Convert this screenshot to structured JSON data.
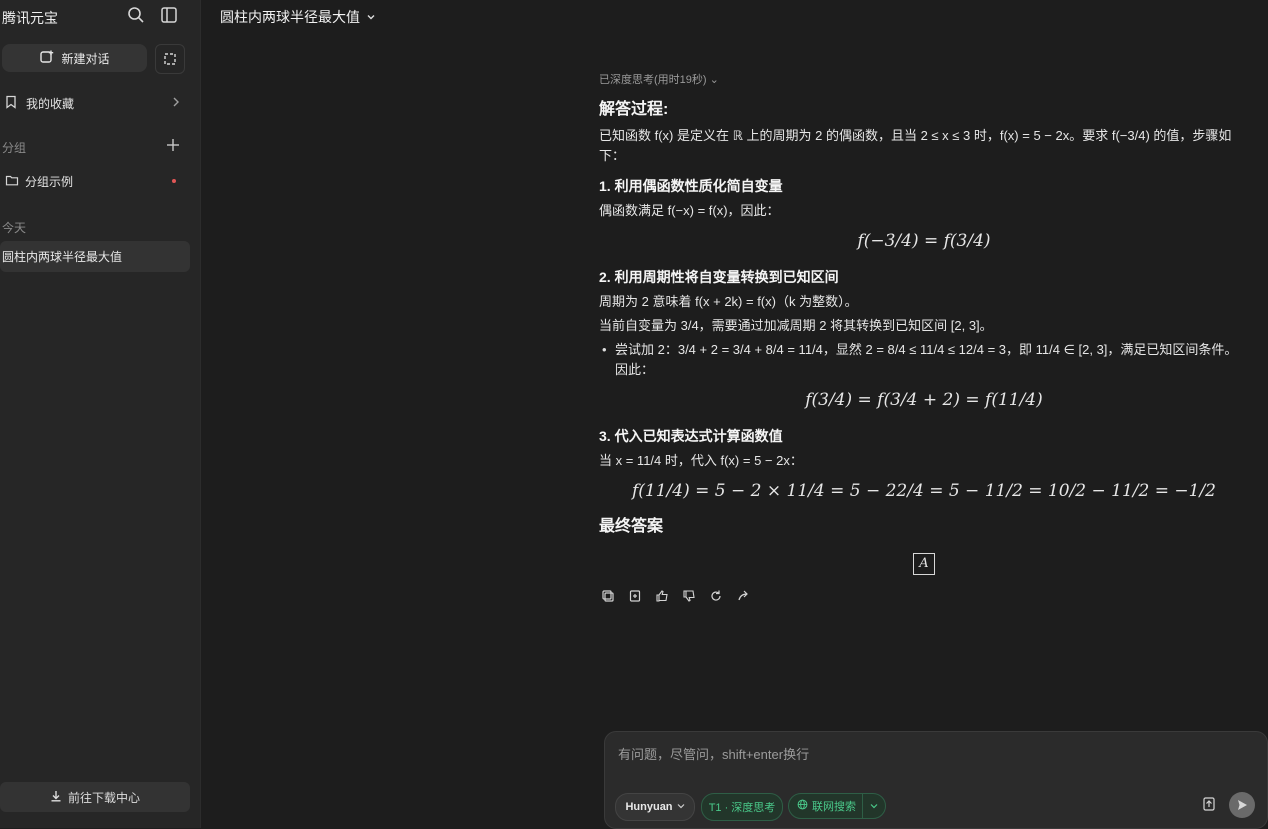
{
  "app": {
    "title": "腾讯元宝",
    "new_chat_label": "新建对话"
  },
  "sidebar": {
    "favorites_label": "我的收藏",
    "groups_label": "分组",
    "group_example_label": "分组示例",
    "today_label": "今天",
    "selected_chat": "圆柱内两球半径最大值",
    "download_label": "前往下载中心"
  },
  "header": {
    "chat_title": "圆柱内两球半径最大值"
  },
  "answer": {
    "thinking": "已深度思考(用时19秒)",
    "heading": "解答过程:",
    "intro": "已知函数 f(x) 是定义在 ℝ 上的周期为 2 的偶函数，且当 2 ≤ x ≤ 3 时，f(x) = 5 − 2x。要求 f(−3/4) 的值，步骤如下：",
    "steps": [
      {
        "title": "1. 利用偶函数性质化简自变量",
        "text": "偶函数满足 f(−x) = f(x)，因此：",
        "display": "f(−3/4) = f(3/4)"
      },
      {
        "title": "2. 利用周期性将自变量转换到已知区间",
        "text1": "周期为 2 意味着 f(x + 2k) = f(x)（k 为整数）。",
        "text2": "当前自变量为 3/4，需要通过加减周期 2 将其转换到已知区间 [2, 3]。",
        "bullet1": "尝试加 2：3/4 + 2 = 3/4 + 8/4 = 11/4，显然 2 = 8/4 ≤ 11/4 ≤ 12/4 = 3，即 11/4 ∈ [2, 3]，满足已知区间条件。",
        "bullet2": "因此：",
        "display": "f(3/4) = f(3/4 + 2) = f(11/4)"
      },
      {
        "title": "3. 代入已知表达式计算函数值",
        "text": "当 x = 11/4 时，代入 f(x) = 5 − 2x：",
        "display": "f(11/4) = 5 − 2 × 11/4 = 5 − 22/4 = 5 − 11/2 = 10/2 − 11/2 = −1/2"
      }
    ],
    "final_title": "最终答案",
    "final_value": "A"
  },
  "composer": {
    "placeholder": "有问题，尽管问，shift+enter换行",
    "model": "Hunyuan",
    "deep_think": "T1 · 深度思考",
    "web_search": "联网搜索"
  }
}
